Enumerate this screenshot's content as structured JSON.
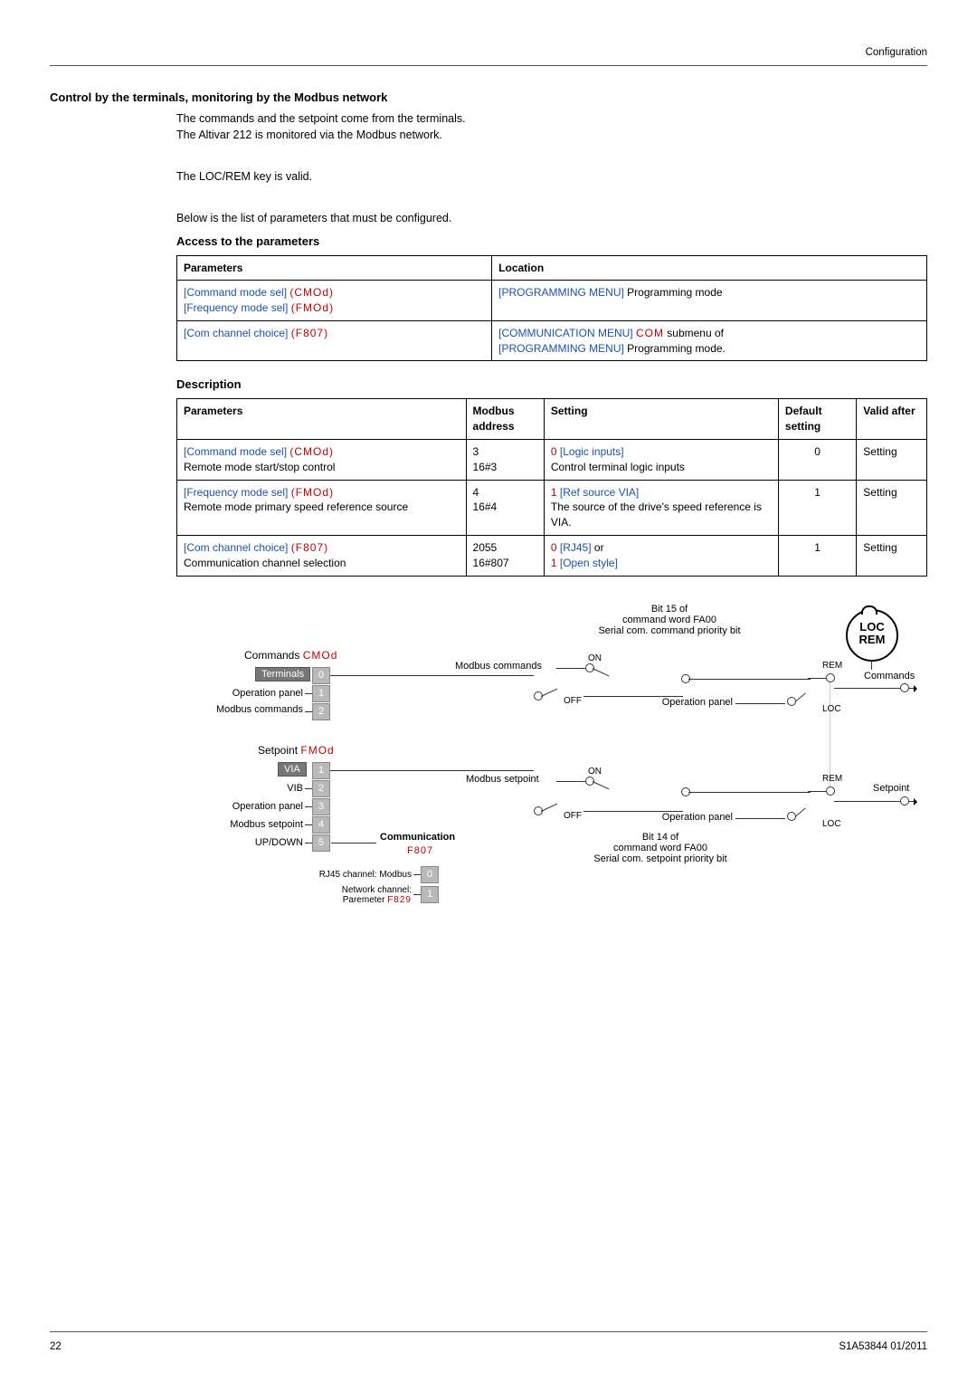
{
  "top": {
    "label": "Configuration"
  },
  "section_heading": "Control by the terminals, monitoring by the Modbus network",
  "paragraphs": {
    "p1": "The commands and the setpoint come from the terminals.",
    "p2": "The Altivar 212 is monitored via the Modbus network.",
    "p3": "The LOC/REM key is valid.",
    "p4": "Below is the list of parameters that must be configured."
  },
  "access_heading": "Access to the parameters",
  "access_table": {
    "headers": {
      "h1": "Parameters",
      "h2": "Location"
    },
    "r1": {
      "p_cmd": "[Command mode sel]",
      "p_cmd_code": "(CMOd)",
      "p_freq": "[Frequency mode sel]",
      "p_freq_code": "(FMOd)",
      "loc": "[PROGRAMMING MENU]",
      "loc_suffix": " Programming mode"
    },
    "r2": {
      "p_com": "[Com channel choice]",
      "p_com_code": "(F807)",
      "loc1": "[COMMUNICATION MENU] ",
      "loc1_code": "COM",
      "loc1_suffix": " submenu of",
      "loc2": "[PROGRAMMING MENU]",
      "loc2_suffix": " Programming mode."
    }
  },
  "desc_heading": "Description",
  "desc_table": {
    "headers": {
      "h1": "Parameters",
      "h2": "Modbus address",
      "h3": "Setting",
      "h4": "Default setting",
      "h5": "Valid after"
    },
    "r1": {
      "p_name": "[Command mode sel]",
      "p_code": "(CMOd)",
      "p_sub": "Remote mode start/stop control",
      "addr_a": "3",
      "addr_b": "16#3",
      "set_val": "0",
      "set_lbl": " [Logic inputs]",
      "set_sub": "Control terminal logic inputs",
      "def": "0",
      "valid": "Setting"
    },
    "r2": {
      "p_name": "[Frequency mode sel]",
      "p_code": "(FMOd)",
      "p_sub": "Remote mode primary speed reference source",
      "addr_a": "4",
      "addr_b": "16#4",
      "set_val": "1",
      "set_lbl": " [Ref source VIA]",
      "set_sub": "The source of the drive's speed reference is VIA.",
      "def": "1",
      "valid": "Setting"
    },
    "r3": {
      "p_name": "[Com channel choice]",
      "p_code": "(F807)",
      "p_sub": "Communication channel selection",
      "addr_a": "2055",
      "addr_b": "16#807",
      "set_val": "0",
      "set_lbl": " [RJ45]",
      "set_or": " or",
      "set2_val": "1",
      "set2_lbl": " [Open style]",
      "def": "1",
      "valid": "Setting"
    }
  },
  "diagram": {
    "top_block": {
      "line1": "Bit 15 of",
      "line2": "command word FA00",
      "line3": "Serial com. command priority bit"
    },
    "commands_heading": "Commands",
    "commands_code": "CMOd",
    "commands_list": {
      "terminals": "Terminals",
      "operation_panel": "Operation panel",
      "modbus_commands": "Modbus commands",
      "n0": "0",
      "n1": "1",
      "n2": "2"
    },
    "setpoint_heading": "Setpoint",
    "setpoint_code": "FMOd",
    "setpoint_list": {
      "via": "VIA",
      "vib": "VIB",
      "operation_panel": "Operation panel",
      "modbus_setpoint": "Modbus setpoint",
      "updown": "UP/DOWN",
      "n1": "1",
      "n2": "2",
      "n3": "3",
      "n4": "4",
      "n5": "5"
    },
    "communication_heading": "Communication",
    "communication_code": "F807",
    "communication_list": {
      "rj45": "RJ45 channel: Modbus",
      "net": "Network channel:",
      "param": "Paremeter ",
      "param_code": "F829",
      "n0": "0",
      "n1": "1"
    },
    "modbus_commands_label": "Modbus commands",
    "modbus_setpoint_label": "Modbus setpoint",
    "on": "ON",
    "off": "OFF",
    "operation_panel": "Operation panel",
    "bot_block": {
      "line1": "Bit 14 of",
      "line2": "command word FA00",
      "line3": "Serial com. setpoint priority bit"
    },
    "rem": "REM",
    "loc": "LOC",
    "locrem_top": "LOC",
    "locrem_bot": "REM",
    "commands_out": "Commands",
    "setpoint_out": "Setpoint"
  },
  "footer": {
    "page": "22",
    "doc": "S1A53844 01/2011"
  }
}
